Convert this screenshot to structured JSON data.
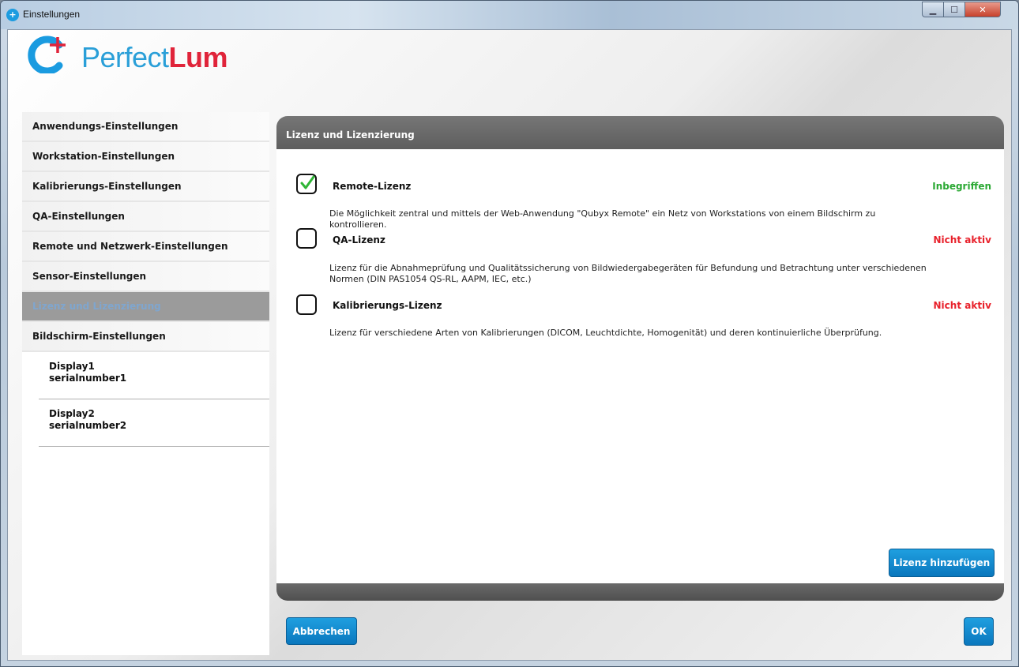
{
  "window": {
    "title": "Einstellungen"
  },
  "logo": {
    "text_primary": "Perfect",
    "text_accent": "Lum"
  },
  "sidebar": {
    "items": [
      {
        "label": "Anwendungs-Einstellungen"
      },
      {
        "label": "Workstation-Einstellungen"
      },
      {
        "label": "Kalibrierungs-Einstellungen"
      },
      {
        "label": "QA-Einstellungen"
      },
      {
        "label": "Remote und Netzwerk-Einstellungen"
      },
      {
        "label": "Sensor-Einstellungen"
      },
      {
        "label": "Lizenz und Lizenzierung",
        "active": true
      },
      {
        "label": "Bildschirm-Einstellungen"
      }
    ],
    "displays": [
      {
        "name": "Display1",
        "serial": "serialnumber1"
      },
      {
        "name": "Display2",
        "serial": "serialnumber2"
      }
    ]
  },
  "panel": {
    "title": "Lizenz und Lizenzierung",
    "licenses": [
      {
        "name": "Remote-Lizenz",
        "checked": true,
        "status": "Inbegriffen",
        "description": "Die Möglichkeit zentral und mittels der Web-Anwendung \"Qubyx Remote\" ein Netz von Workstations von einem Bildschirm zu kontrollieren."
      },
      {
        "name": "QA-Lizenz",
        "checked": false,
        "status": "Nicht aktiv",
        "description": "Lizenz für die Abnahmeprüfung und Qualitätssicherung von Bildwiedergabegeräten für Befundung und Betrachtung unter verschiedenen Normen (DIN PAS1054 QS-RL, AAPM, IEC, etc.)"
      },
      {
        "name": "Kalibrierungs-Lizenz",
        "checked": false,
        "status": "Nicht aktiv",
        "description": "Lizenz für verschiedene Arten von Kalibrierungen (DICOM, Leuchtdichte, Homogenität) und deren kontinuierliche Überprüfung."
      }
    ],
    "add_license_button": "Lizenz hinzufügen"
  },
  "footer": {
    "cancel_button": "Abbrechen",
    "ok_button": "OK"
  },
  "colors": {
    "accent": "#1a8fd5",
    "included": "#2aa833",
    "inactive": "#e8212b",
    "brand_red": "#e0243a"
  }
}
